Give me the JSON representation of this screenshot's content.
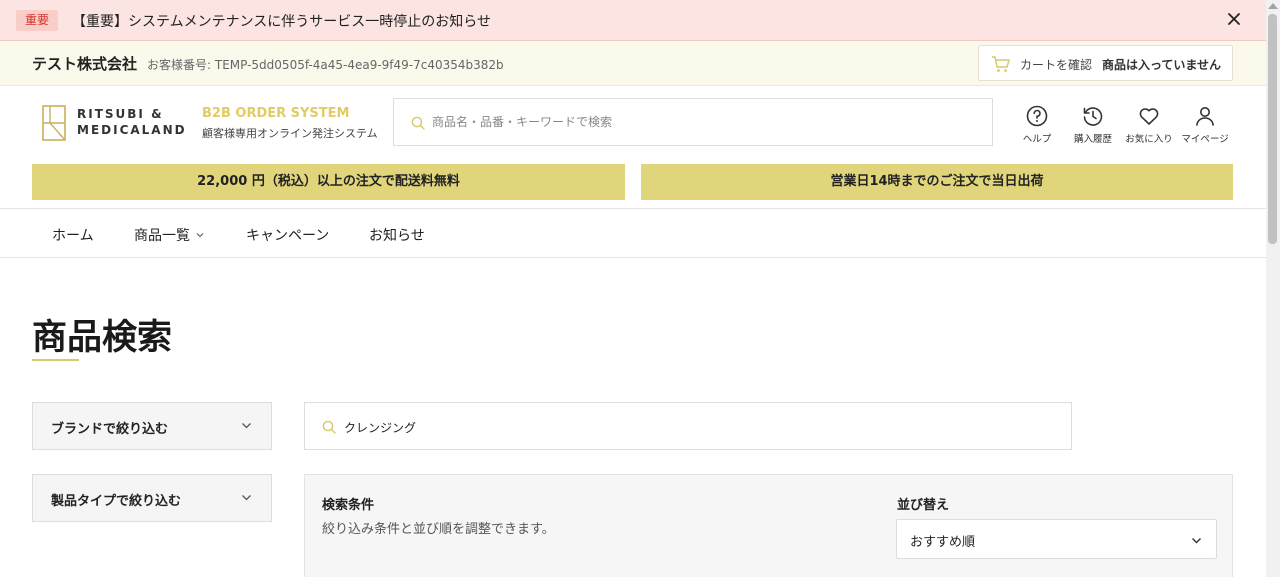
{
  "announcement": {
    "badge": "重要",
    "message": "【重要】システムメンテナンスに伴うサービス一時停止のお知らせ"
  },
  "company_bar": {
    "company_name": "テスト株式会社",
    "customer_number": "お客様番号: TEMP-5dd0505f-4a45-4ea9-9f49-7c40354b382b",
    "cart_check_label": "カートを確認",
    "cart_status": "商品は入っていません"
  },
  "header": {
    "logo_line1": "RITSUBI &",
    "logo_line2": "MEDICALAND",
    "system_title": "B2B ORDER SYSTEM",
    "system_subtitle": "顧客様専用オンライン発注システム",
    "search_placeholder": "商品名・品番・キーワードで検索",
    "nav": {
      "help": "ヘルプ",
      "history": "購入履歴",
      "favorites": "お気に入り",
      "mypage": "マイページ"
    }
  },
  "promos": {
    "shipping": "22,000 円（税込）以上の注文で配送料無料",
    "same_day": "営業日14時までのご注文で当日出荷"
  },
  "menu": {
    "home": "ホーム",
    "products": "商品一覧",
    "campaign": "キャンペーン",
    "news": "お知らせ"
  },
  "main": {
    "title": "商品検索",
    "filters": {
      "brand": "ブランドで絞り込む",
      "type": "製品タイプで絞り込む"
    },
    "query": "クレンジング",
    "conditions": {
      "title": "検索条件",
      "description": "絞り込み条件と並び順を調整できます。",
      "sort_label": "並び替え",
      "sort_value": "おすすめ順"
    }
  },
  "colors": {
    "accent": "#e1d57c",
    "accent_text": "#e0cc63",
    "announce_bg": "#fbe4e1",
    "badge_text": "#d0342c"
  }
}
